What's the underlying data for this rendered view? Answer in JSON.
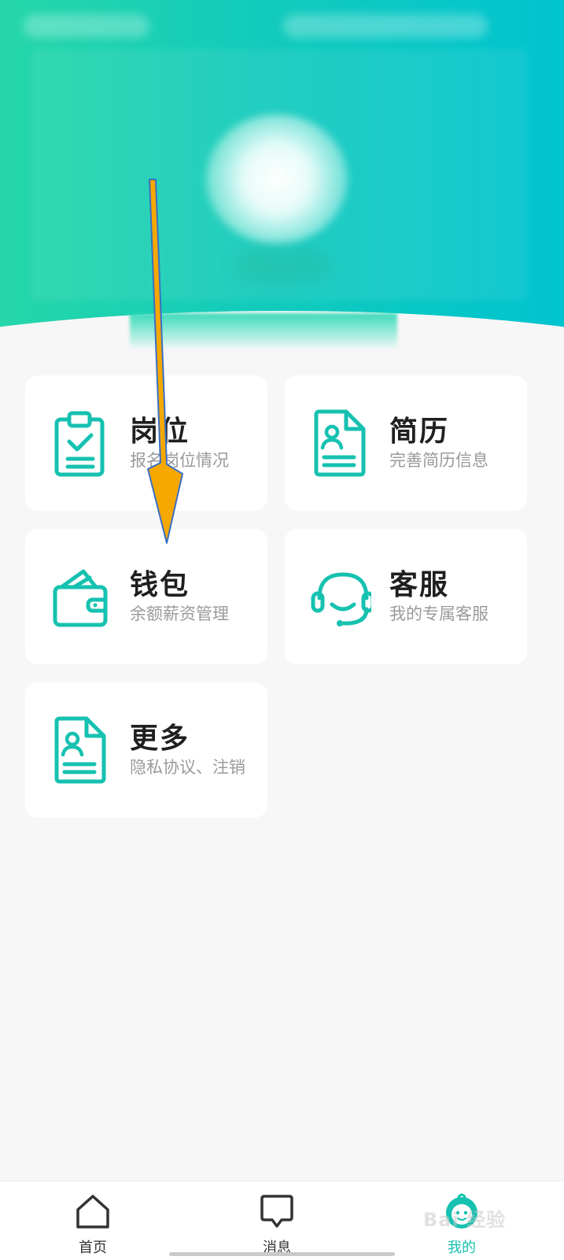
{
  "colors": {
    "accent": "#16c1b0",
    "header_left": "#25d7a9",
    "header_right": "#00c4cf",
    "background": "#f8f7f8",
    "card": "#ffffff",
    "arrow_fill": "#f5a800",
    "arrow_stroke": "#3b6fc4"
  },
  "menu": {
    "items": [
      {
        "title": "岗位",
        "subtitle": "报名岗位情况",
        "icon": "clipboard-check-icon"
      },
      {
        "title": "简历",
        "subtitle": "完善简历信息",
        "icon": "resume-document-icon"
      },
      {
        "title": "钱包",
        "subtitle": "余额薪资管理",
        "icon": "wallet-icon"
      },
      {
        "title": "客服",
        "subtitle": "我的专属客服",
        "icon": "headset-icon"
      },
      {
        "title": "更多",
        "subtitle": "隐私协议、注销",
        "icon": "document-person-icon"
      }
    ]
  },
  "tabbar": {
    "items": [
      {
        "label": "首页",
        "icon": "home-icon",
        "active": false
      },
      {
        "label": "消息",
        "icon": "message-icon",
        "active": false
      },
      {
        "label": "我的",
        "icon": "profile-mascot-icon",
        "active": true
      }
    ]
  },
  "watermark": {
    "text": "Bai 经验"
  }
}
